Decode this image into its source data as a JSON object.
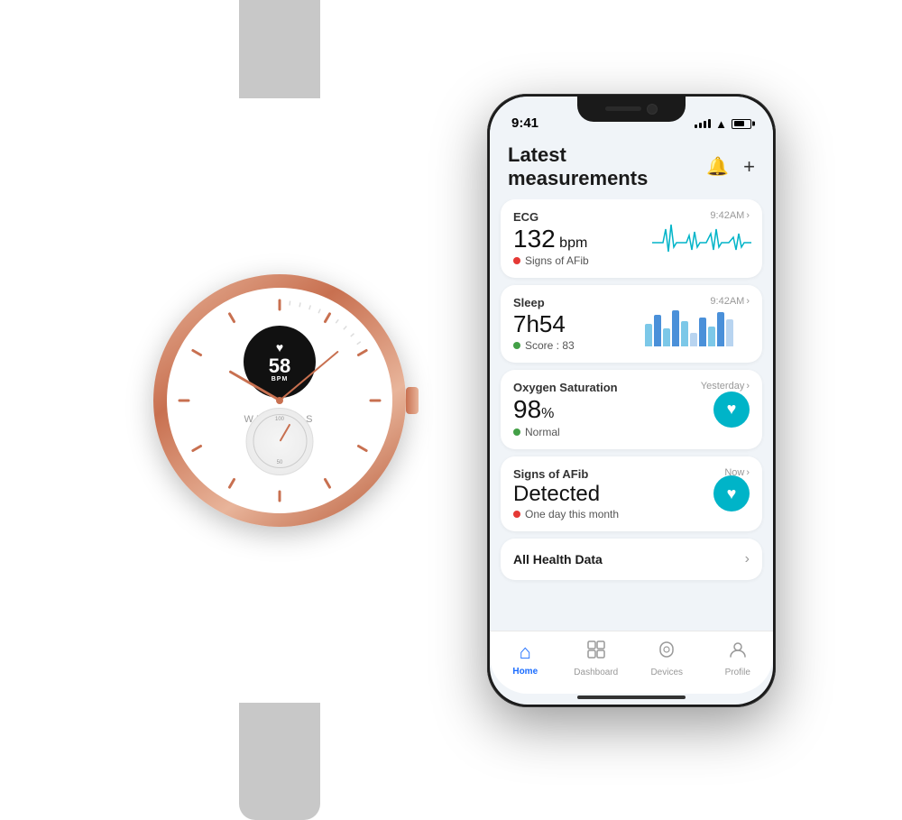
{
  "watch": {
    "brand": "WITHINGS",
    "hr_value": "58",
    "hr_unit": "BPM",
    "heart_icon": "♥",
    "sub_dial_100": "100",
    "sub_dial_50": "50"
  },
  "phone": {
    "status": {
      "time": "9:41"
    },
    "header": {
      "title": "Latest measurements",
      "bell_icon": "🔔",
      "plus_icon": "+"
    },
    "cards": [
      {
        "metric": "ECG",
        "timestamp": "9:42AM",
        "value": "132",
        "unit": " bpm",
        "status_dot": "red",
        "status_text": "Signs of AFib",
        "has_chart": "ecg"
      },
      {
        "metric": "Sleep",
        "timestamp": "9:42AM",
        "value": "7h54",
        "unit": "",
        "status_dot": "green",
        "status_text": "Score : 83",
        "has_chart": "sleep"
      },
      {
        "metric": "Oxygen Saturation",
        "timestamp": "Yesterday",
        "value": "98",
        "unit": "%",
        "status_dot": "green",
        "status_text": "Normal",
        "has_chart": "icon"
      },
      {
        "metric": "Signs of AFib",
        "timestamp": "Now",
        "value": "Detected",
        "unit": "",
        "status_dot": "red",
        "status_text": "One day this month",
        "has_chart": "icon"
      }
    ],
    "all_health": "All Health Data",
    "nav": [
      {
        "icon": "⌂",
        "label": "Home",
        "active": true
      },
      {
        "icon": "📋",
        "label": "Dashboard",
        "active": false
      },
      {
        "icon": "⌚",
        "label": "Devices",
        "active": false
      },
      {
        "icon": "👤",
        "label": "Profile",
        "active": false
      }
    ]
  }
}
